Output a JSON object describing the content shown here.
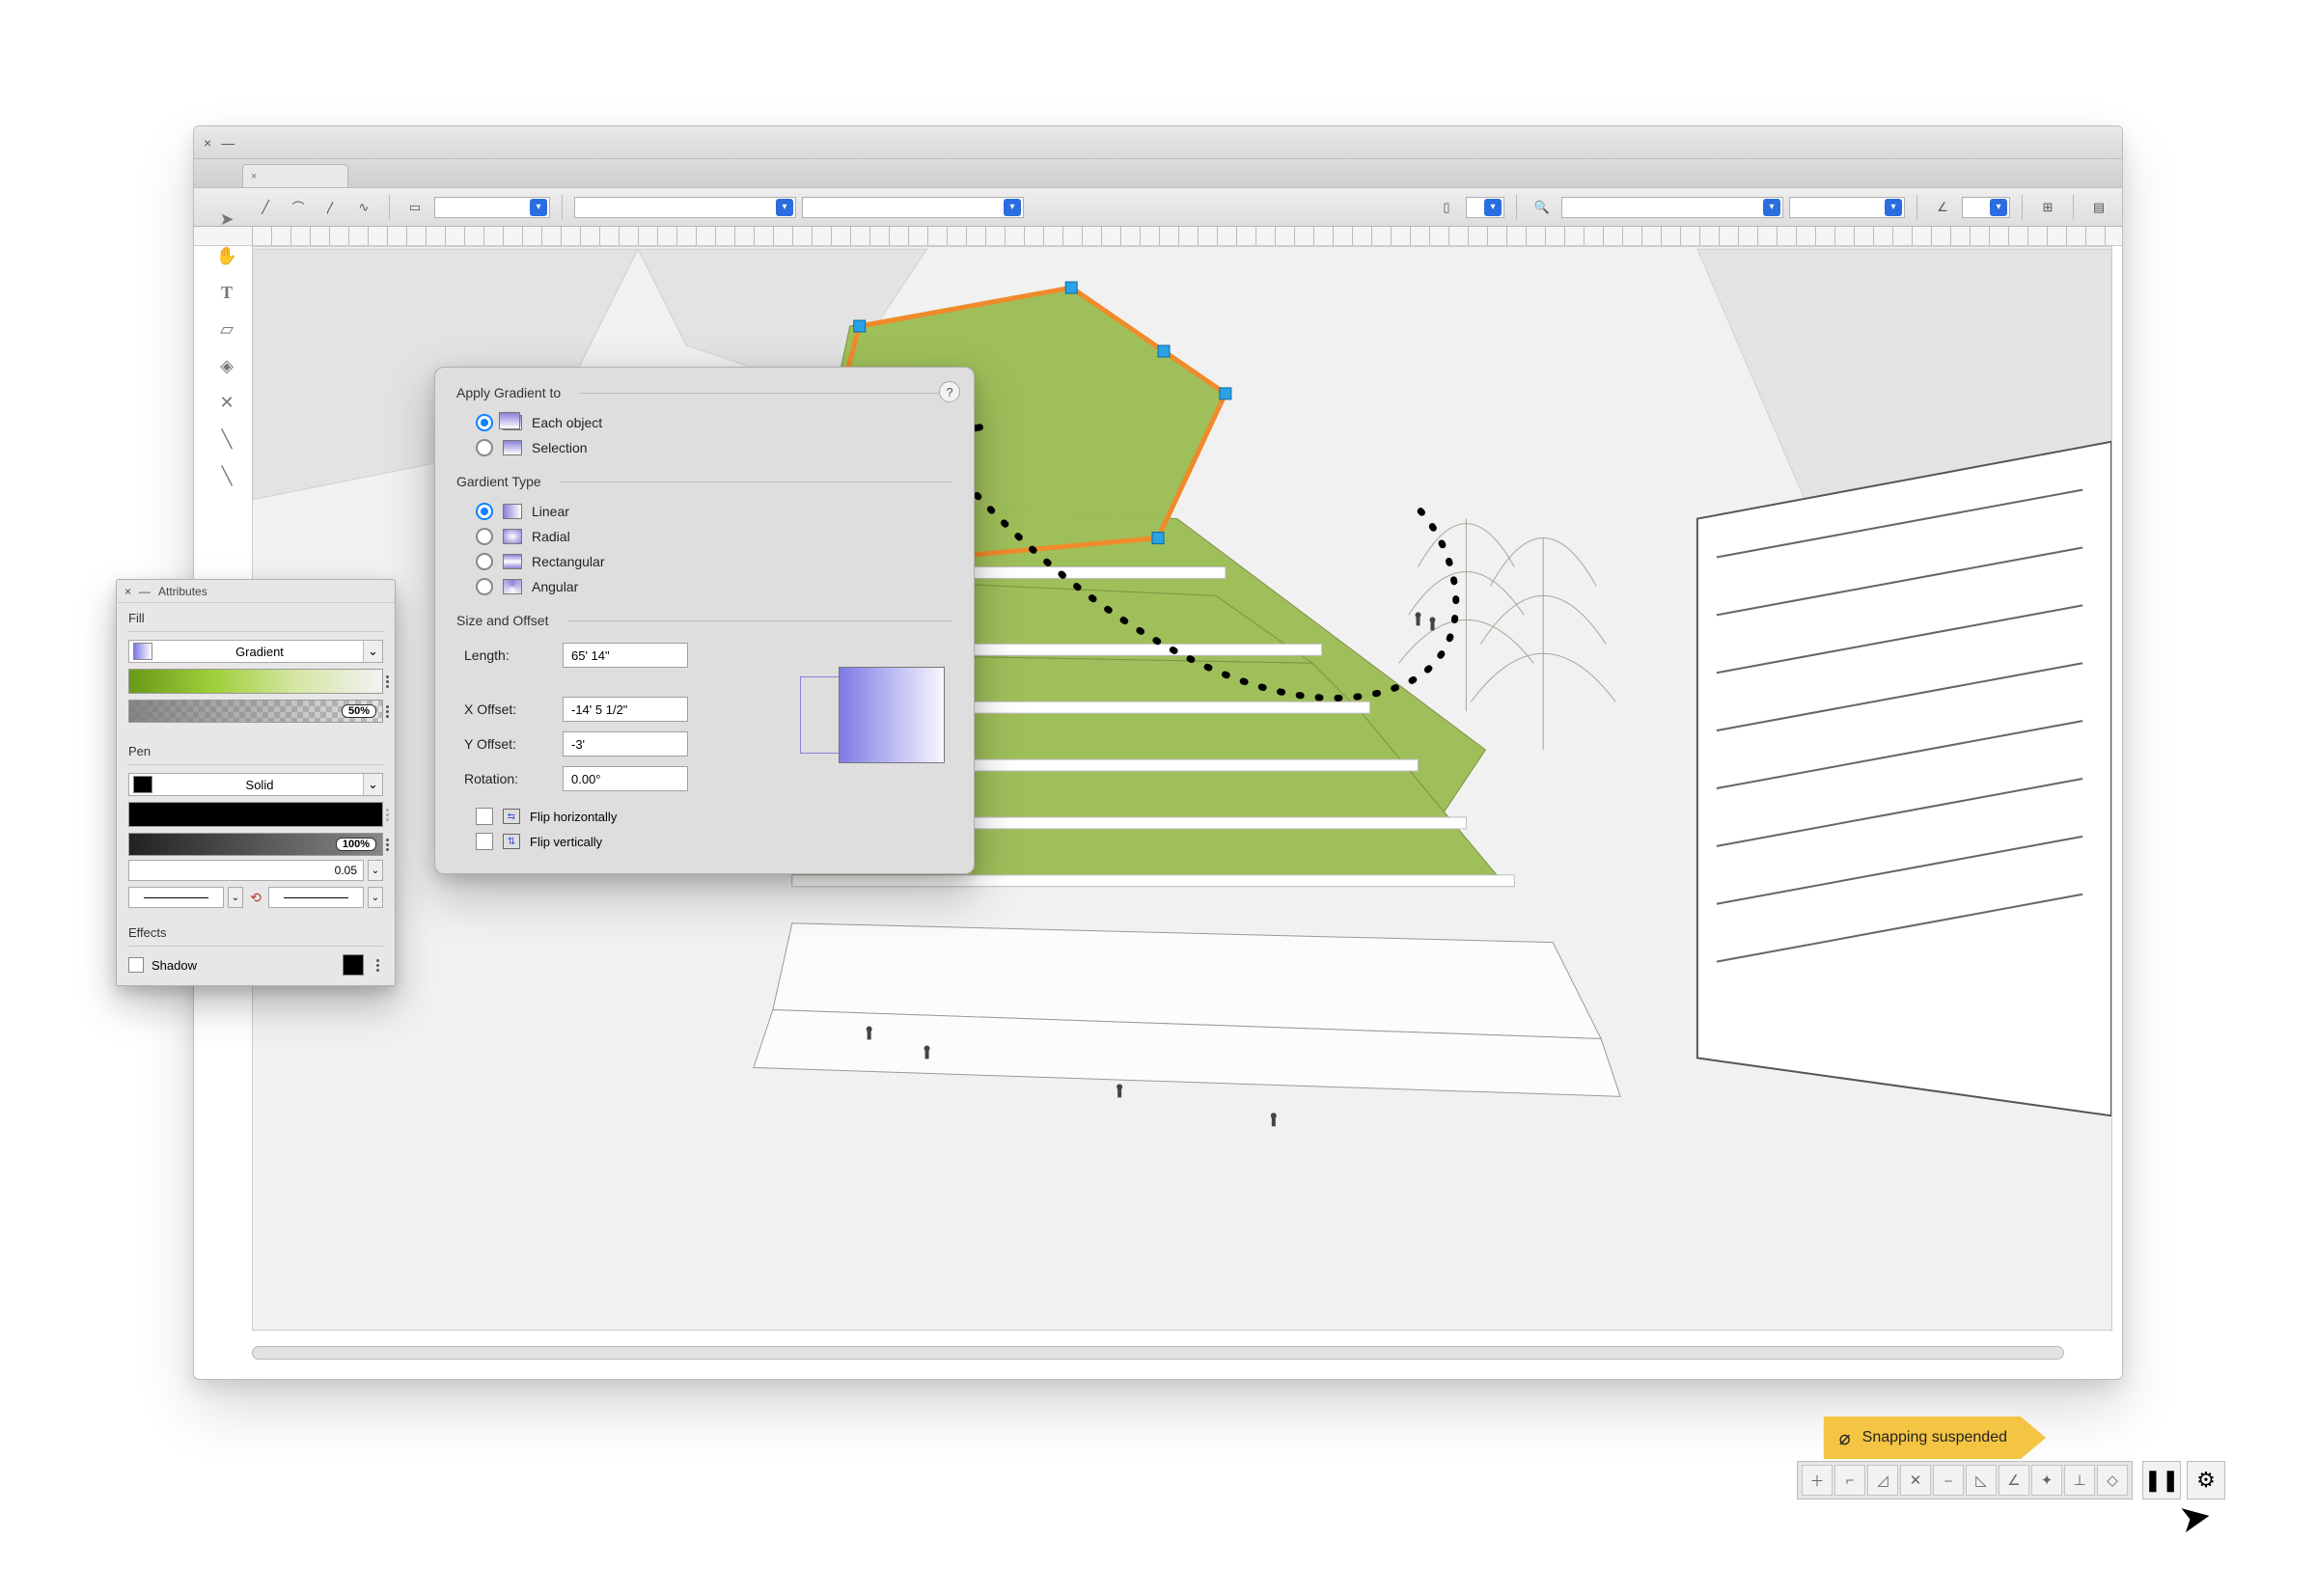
{
  "window": {
    "close_glyph": "×",
    "minimize_glyph": "—"
  },
  "attributes_panel": {
    "title": "Attributes",
    "fill": {
      "section_label": "Fill",
      "mode": "Gradient",
      "opacity_badge": "50%"
    },
    "pen": {
      "section_label": "Pen",
      "mode": "Solid",
      "opacity_badge": "100%",
      "weight": "0.05"
    },
    "effects": {
      "section_label": "Effects",
      "shadow_label": "Shadow"
    }
  },
  "gradient_popup": {
    "apply_to": {
      "title": "Apply Gradient to",
      "each_object": "Each object",
      "selection": "Selection"
    },
    "type": {
      "title": "Gardient Type",
      "linear": "Linear",
      "radial": "Radial",
      "rectangular": "Rectangular",
      "angular": "Angular"
    },
    "size_offset": {
      "title": "Size and Offset",
      "length_label": "Length:",
      "length_value": "65' 14\"",
      "xoffset_label": "X Offset:",
      "xoffset_value": "-14' 5 1/2\"",
      "yoffset_label": "Y Offset:",
      "yoffset_value": "-3'",
      "rotation_label": "Rotation:",
      "rotation_value": "0.00°",
      "flip_h": "Flip horizontally",
      "flip_v": "Flip vertically"
    },
    "help_glyph": "?"
  },
  "snap_toast": {
    "text": "Snapping suspended"
  },
  "colors": {
    "accent_blue": "#0a84ff",
    "selection_orange": "#f08a2b",
    "handle_blue": "#2aa3e6",
    "toast_yellow": "#f4c443",
    "gradient_green_dark": "#6a9919",
    "gradient_green_light": "#9fcf3a"
  }
}
